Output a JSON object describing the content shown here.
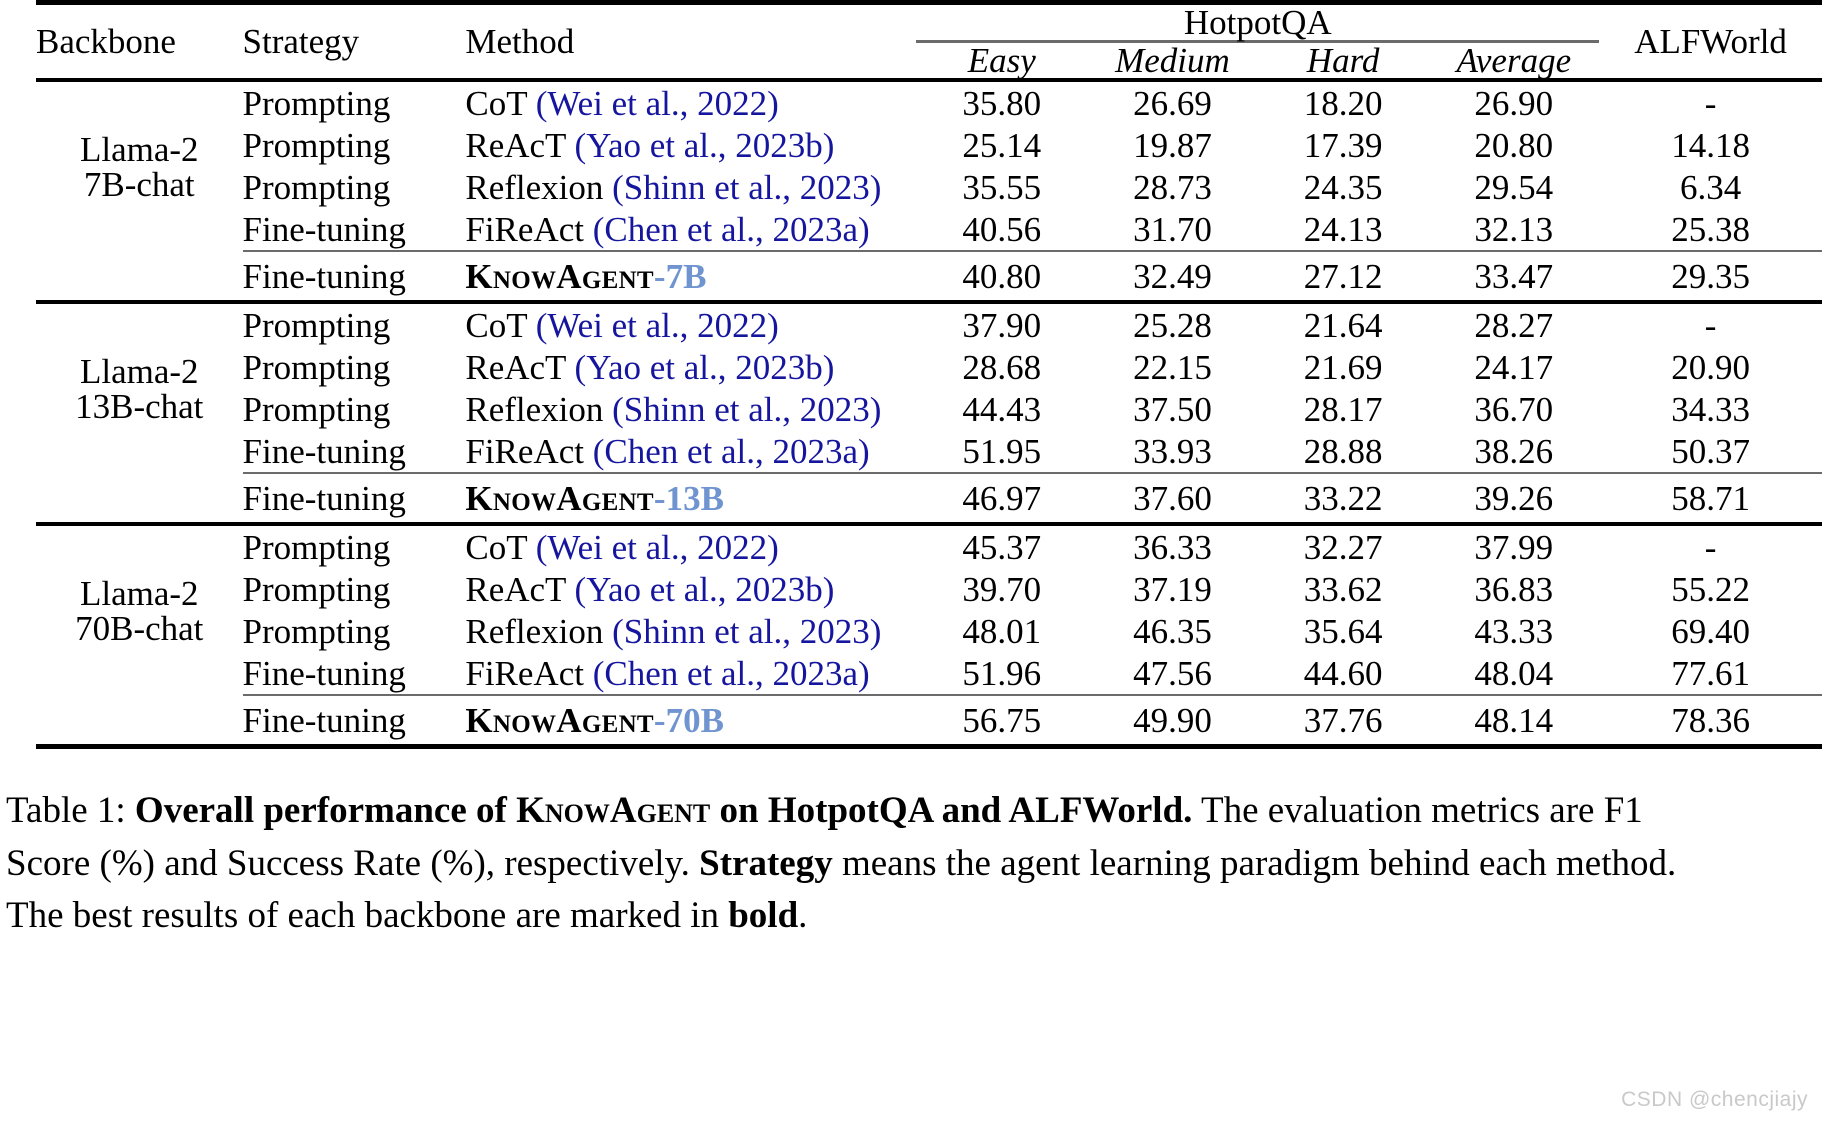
{
  "table": {
    "headers": {
      "backbone": "Backbone",
      "strategy": "Strategy",
      "method": "Method",
      "group_hotpotqa": "HotpotQA",
      "alfworld": "ALFWorld",
      "sub": [
        "Easy",
        "Medium",
        "Hard",
        "Average"
      ]
    },
    "colors": {
      "citation_blue": "#15159e",
      "model_size_blue": "#6f94cf",
      "rule_black": "#000000",
      "rule_gray": "#6b6b6b"
    },
    "blocks": [
      {
        "backbone_line1": "Llama-2",
        "backbone_line2": "7B-chat",
        "rows": [
          {
            "strategy": "Prompting",
            "method_name": "CoT ",
            "method_cite": "(Wei et al., 2022)",
            "easy": "35.80",
            "medium": "26.69",
            "hard": "18.20",
            "average": "26.90",
            "alfworld": "-",
            "bold": []
          },
          {
            "strategy": "Prompting",
            "method_name": "ReAcT ",
            "method_cite": "(Yao et al., 2023b)",
            "easy": "25.14",
            "medium": "19.87",
            "hard": "17.39",
            "average": "20.80",
            "alfworld": "14.18",
            "bold": []
          },
          {
            "strategy": "Prompting",
            "method_name": "Reflexion ",
            "method_cite": "(Shinn et al., 2023)",
            "easy": "35.55",
            "medium": "28.73",
            "hard": "24.35",
            "average": "29.54",
            "alfworld": "6.34",
            "bold": []
          },
          {
            "strategy": "Fine-tuning",
            "method_name": "FiReAct ",
            "method_cite": "(Chen et al., 2023a)",
            "easy": "40.56",
            "medium": "31.70",
            "hard": "24.13",
            "average": "32.13",
            "alfworld": "25.38",
            "bold": []
          }
        ],
        "final_row": {
          "strategy": "Fine-tuning",
          "method_prefix": "KnowAgent",
          "method_suffix": "-7B",
          "easy": "40.80",
          "medium": "32.49",
          "hard": "27.12",
          "average": "33.47",
          "alfworld": "29.35",
          "bold": [
            "easy",
            "medium",
            "hard",
            "average",
            "alfworld"
          ]
        }
      },
      {
        "backbone_line1": "Llama-2",
        "backbone_line2": "13B-chat",
        "rows": [
          {
            "strategy": "Prompting",
            "method_name": "CoT ",
            "method_cite": "(Wei et al., 2022)",
            "easy": "37.90",
            "medium": "25.28",
            "hard": "21.64",
            "average": "28.27",
            "alfworld": "-",
            "bold": []
          },
          {
            "strategy": "Prompting",
            "method_name": "ReAcT ",
            "method_cite": "(Yao et al., 2023b)",
            "easy": "28.68",
            "medium": "22.15",
            "hard": "21.69",
            "average": "24.17",
            "alfworld": "20.90",
            "bold": []
          },
          {
            "strategy": "Prompting",
            "method_name": "Reflexion ",
            "method_cite": "(Shinn et al., 2023)",
            "easy": "44.43",
            "medium": "37.50",
            "hard": "28.17",
            "average": "36.70",
            "alfworld": "34.33",
            "bold": []
          },
          {
            "strategy": "Fine-tuning",
            "method_name": "FiReAct ",
            "method_cite": "(Chen et al., 2023a)",
            "easy": "51.95",
            "medium": "33.93",
            "hard": "28.88",
            "average": "38.26",
            "alfworld": "50.37",
            "bold": [
              "easy"
            ]
          }
        ],
        "final_row": {
          "strategy": "Fine-tuning",
          "method_prefix": "KnowAgent",
          "method_suffix": "-13B",
          "easy": "46.97",
          "medium": "37.60",
          "hard": "33.22",
          "average": "39.26",
          "alfworld": "58.71",
          "bold": [
            "medium",
            "hard",
            "average",
            "alfworld"
          ]
        }
      },
      {
        "backbone_line1": "Llama-2",
        "backbone_line2": "70B-chat",
        "rows": [
          {
            "strategy": "Prompting",
            "method_name": "CoT  ",
            "method_cite": "(Wei et al., 2022)",
            "easy": "45.37",
            "medium": "36.33",
            "hard": "32.27",
            "average": "37.99",
            "alfworld": "-",
            "bold": []
          },
          {
            "strategy": "Prompting",
            "method_name": "ReAcT ",
            "method_cite": "(Yao et al., 2023b)",
            "easy": "39.70",
            "medium": "37.19",
            "hard": "33.62",
            "average": "36.83",
            "alfworld": "55.22",
            "bold": []
          },
          {
            "strategy": "Prompting",
            "method_name": "Reflexion ",
            "method_cite": "(Shinn et al., 2023)",
            "easy": "48.01",
            "medium": "46.35",
            "hard": "35.64",
            "average": "43.33",
            "alfworld": "69.40",
            "bold": []
          },
          {
            "strategy": "Fine-tuning",
            "method_name": "FiReAct ",
            "method_cite": "(Chen et al., 2023a)",
            "easy": "51.96",
            "medium": "47.56",
            "hard": "44.60",
            "average": "48.04",
            "alfworld": "77.61",
            "bold": [
              "hard"
            ]
          }
        ],
        "final_row": {
          "strategy": "Fine-tuning",
          "method_prefix": "KnowAgent",
          "method_suffix": "-70B",
          "easy": "56.75",
          "medium": "49.90",
          "hard": "37.76",
          "average": "48.14",
          "alfworld": "78.36",
          "bold": [
            "easy",
            "medium",
            "average",
            "alfworld"
          ]
        }
      }
    ]
  },
  "caption": {
    "label": "Table 1: ",
    "bold_title_pre": "Overall performance of ",
    "bold_title_sc": "KnowAgent",
    "bold_title_post": " on HotpotQA and ALFWorld.",
    "rest_1": " The evaluation metrics are F1",
    "line2_pre": "Score (%) and Success Rate (%), respectively. ",
    "line2_bold": "Strategy",
    "line2_post": " means the agent learning paradigm behind each method.",
    "line3_pre": "The best results of each backbone are marked in ",
    "line3_bold": "bold",
    "line3_post": "."
  },
  "watermark": "CSDN @chencjiajy"
}
